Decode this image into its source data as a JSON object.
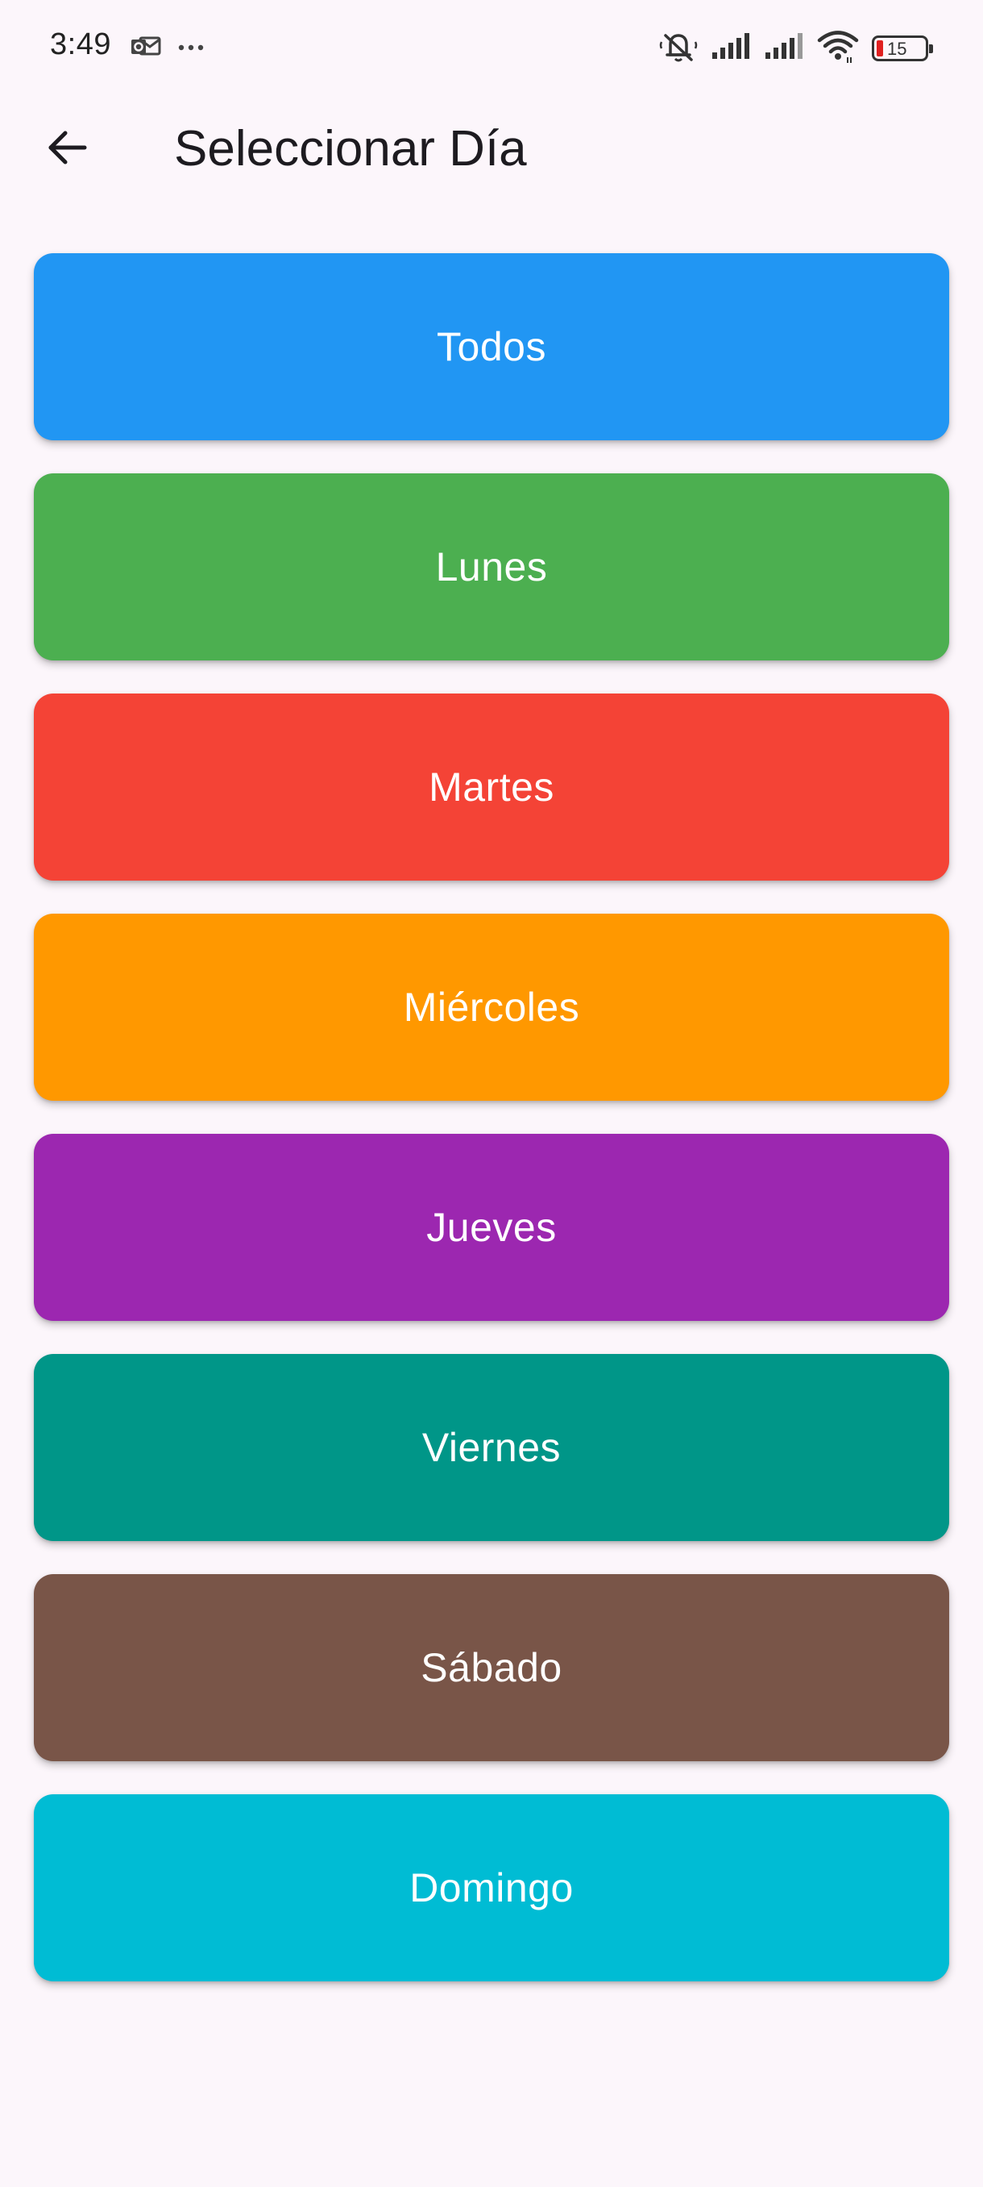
{
  "status_bar": {
    "time": "3:49",
    "battery_level": "15",
    "icons": [
      "outlook-notification-icon",
      "more-dots-icon",
      "mute-icon",
      "signal-icon",
      "signal-icon",
      "wifi-icon",
      "battery-icon"
    ]
  },
  "app_bar": {
    "back_icon": "arrow-back-icon",
    "title": "Seleccionar Día"
  },
  "days": [
    {
      "label": "Todos",
      "color": "#2196f3"
    },
    {
      "label": "Lunes",
      "color": "#4caf50"
    },
    {
      "label": "Martes",
      "color": "#f44336"
    },
    {
      "label": "Miércoles",
      "color": "#ff9800"
    },
    {
      "label": "Jueves",
      "color": "#9c27b0"
    },
    {
      "label": "Viernes",
      "color": "#009688"
    },
    {
      "label": "Sábado",
      "color": "#795548"
    },
    {
      "label": "Domingo",
      "color": "#00bcd4"
    }
  ],
  "colors": {
    "background": "#fcf6fb",
    "text": "#1d1b20",
    "battery_low": "#e02020"
  }
}
